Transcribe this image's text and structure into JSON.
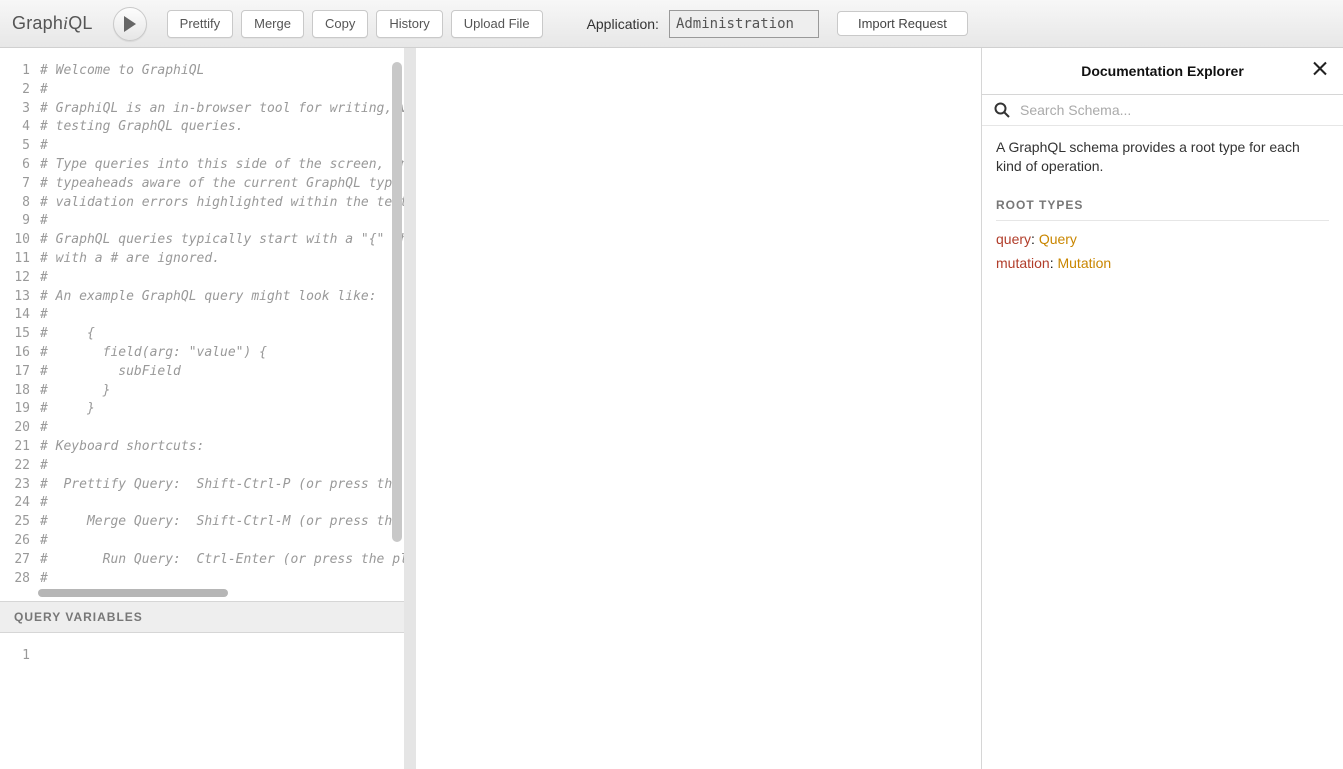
{
  "logo": {
    "prefix": "Graph",
    "i": "i",
    "suffix": "QL"
  },
  "toolbar": {
    "prettify": "Prettify",
    "merge": "Merge",
    "copy": "Copy",
    "history": "History",
    "upload": "Upload File",
    "app_label": "Application:",
    "app_value": "Administration",
    "import": "Import Request"
  },
  "editor": {
    "lines": [
      "# Welcome to GraphiQL",
      "#",
      "# GraphiQL is an in-browser tool for writing, validating, and",
      "# testing GraphQL queries.",
      "#",
      "# Type queries into this side of the screen, and you will see intelligent",
      "# typeaheads aware of the current GraphQL type schema and live syntax and",
      "# validation errors highlighted within the text.",
      "#",
      "# GraphQL queries typically start with a \"{\" character. Lines that start",
      "# with a # are ignored.",
      "#",
      "# An example GraphQL query might look like:",
      "#",
      "#     {",
      "#       field(arg: \"value\") {",
      "#         subField",
      "#       }",
      "#     }",
      "#",
      "# Keyboard shortcuts:",
      "#",
      "#  Prettify Query:  Shift-Ctrl-P (or press the prettify button above)",
      "#",
      "#     Merge Query:  Shift-Ctrl-M (or press the merge button above)",
      "#",
      "#       Run Query:  Ctrl-Enter (or press the play button above)",
      "#"
    ],
    "variables_title": "Query Variables",
    "variables_line_1": "1"
  },
  "docs": {
    "title": "Documentation Explorer",
    "search_placeholder": "Search Schema...",
    "description": "A GraphQL schema provides a root type for each kind of operation.",
    "root_types_heading": "Root Types",
    "roots": [
      {
        "field": "query",
        "type": "Query"
      },
      {
        "field": "mutation",
        "type": "Mutation"
      }
    ]
  }
}
